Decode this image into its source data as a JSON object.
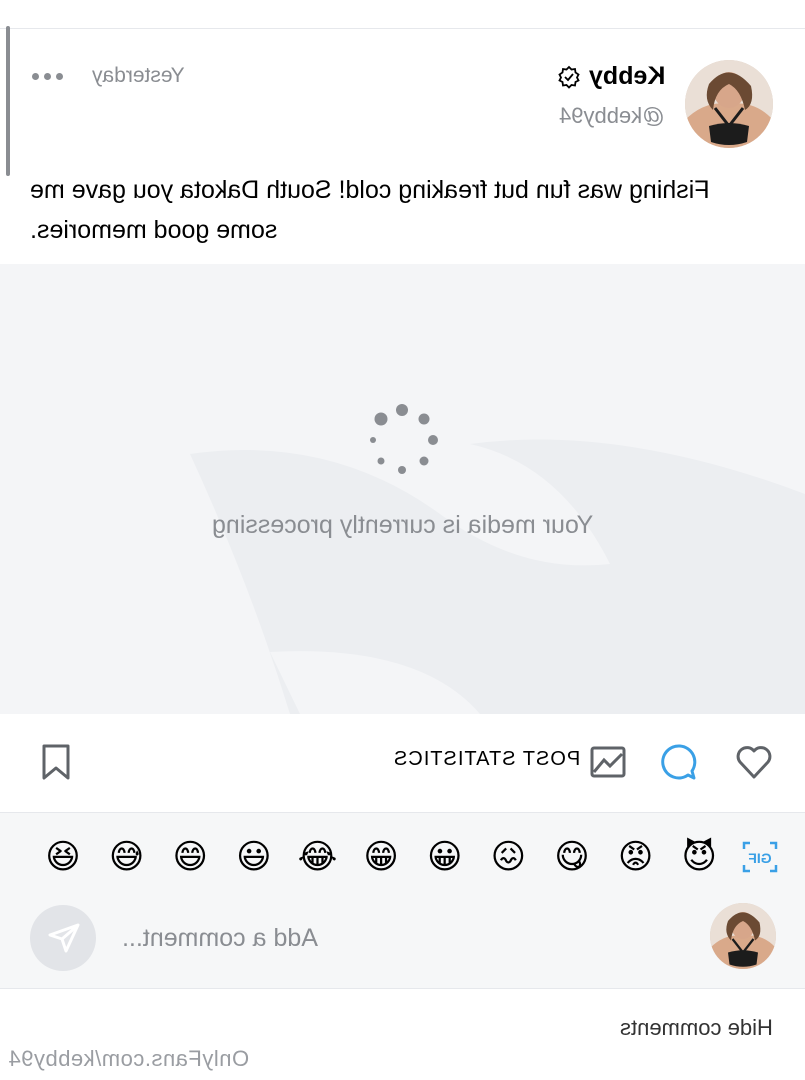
{
  "post": {
    "author_name": "Kebby",
    "author_handle": "@kebby94",
    "timestamp": "Yesterday",
    "text": "Fishing was fun but freaking cold! South Dakota you gave me some good memories."
  },
  "media": {
    "status_text": "Your media is currently processing"
  },
  "actions": {
    "stats_label": "POST STATISTICS"
  },
  "emoji_bar": {
    "items": [
      "😆",
      "😅",
      "😄",
      "😃",
      "😂",
      "😁",
      "😀",
      "😖",
      "😋",
      "😡",
      "😈"
    ],
    "gif_label": "GIF"
  },
  "comment": {
    "placeholder": "Add a comment..."
  },
  "footer": {
    "hide_comments": "Hide comments",
    "watermark": "OnlyFans.com/kebby94"
  },
  "colors": {
    "accent": "#3aa0e6",
    "muted": "#8a8d92",
    "media_bg": "#f4f5f7"
  },
  "icons": [
    "more-icon",
    "verified-icon",
    "spinner-icon",
    "bookmark-icon",
    "stats-icon",
    "comment-icon",
    "heart-icon",
    "gif-icon",
    "send-icon"
  ]
}
